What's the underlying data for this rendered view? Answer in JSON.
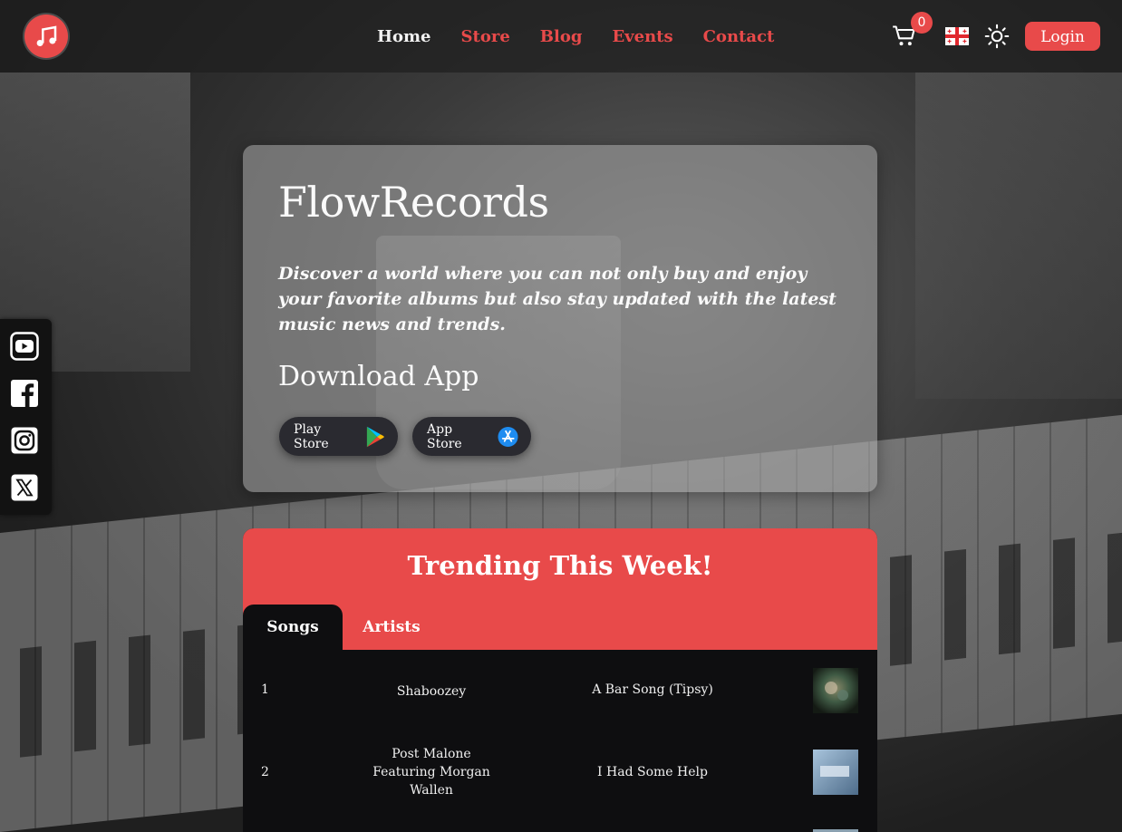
{
  "header": {
    "nav": [
      {
        "label": "Home",
        "active": true
      },
      {
        "label": "Store",
        "active": false
      },
      {
        "label": "Blog",
        "active": false
      },
      {
        "label": "Events",
        "active": false
      },
      {
        "label": "Contact",
        "active": false
      }
    ],
    "cart_count": "0",
    "login_label": "Login",
    "icons": [
      "music-note-logo",
      "cart-icon",
      "georgia-flag-icon",
      "sun-icon"
    ]
  },
  "social": {
    "icons": [
      "youtube-icon",
      "facebook-icon",
      "instagram-icon",
      "x-icon"
    ]
  },
  "hero": {
    "title": "FlowRecords",
    "description": "Discover a world where you can not only buy and enjoy your favorite albums but also stay updated with the latest music news and trends.",
    "download_heading": "Download App",
    "play_store_label": "Play Store",
    "app_store_label": "App Store"
  },
  "trending": {
    "title": "Trending This Week!",
    "tabs": [
      {
        "label": "Songs",
        "active": true
      },
      {
        "label": "Artists",
        "active": false
      }
    ],
    "rows": [
      {
        "rank": "1",
        "artist": "Shaboozey",
        "song": "A Bar Song (Tipsy)"
      },
      {
        "rank": "2",
        "artist": "Post Malone Featuring Morgan Wallen",
        "song": "I Had Some Help"
      }
    ]
  },
  "colors": {
    "accent": "#e84a4a",
    "header_bg": "#1e1e1e",
    "dark": "#0e0e10"
  }
}
